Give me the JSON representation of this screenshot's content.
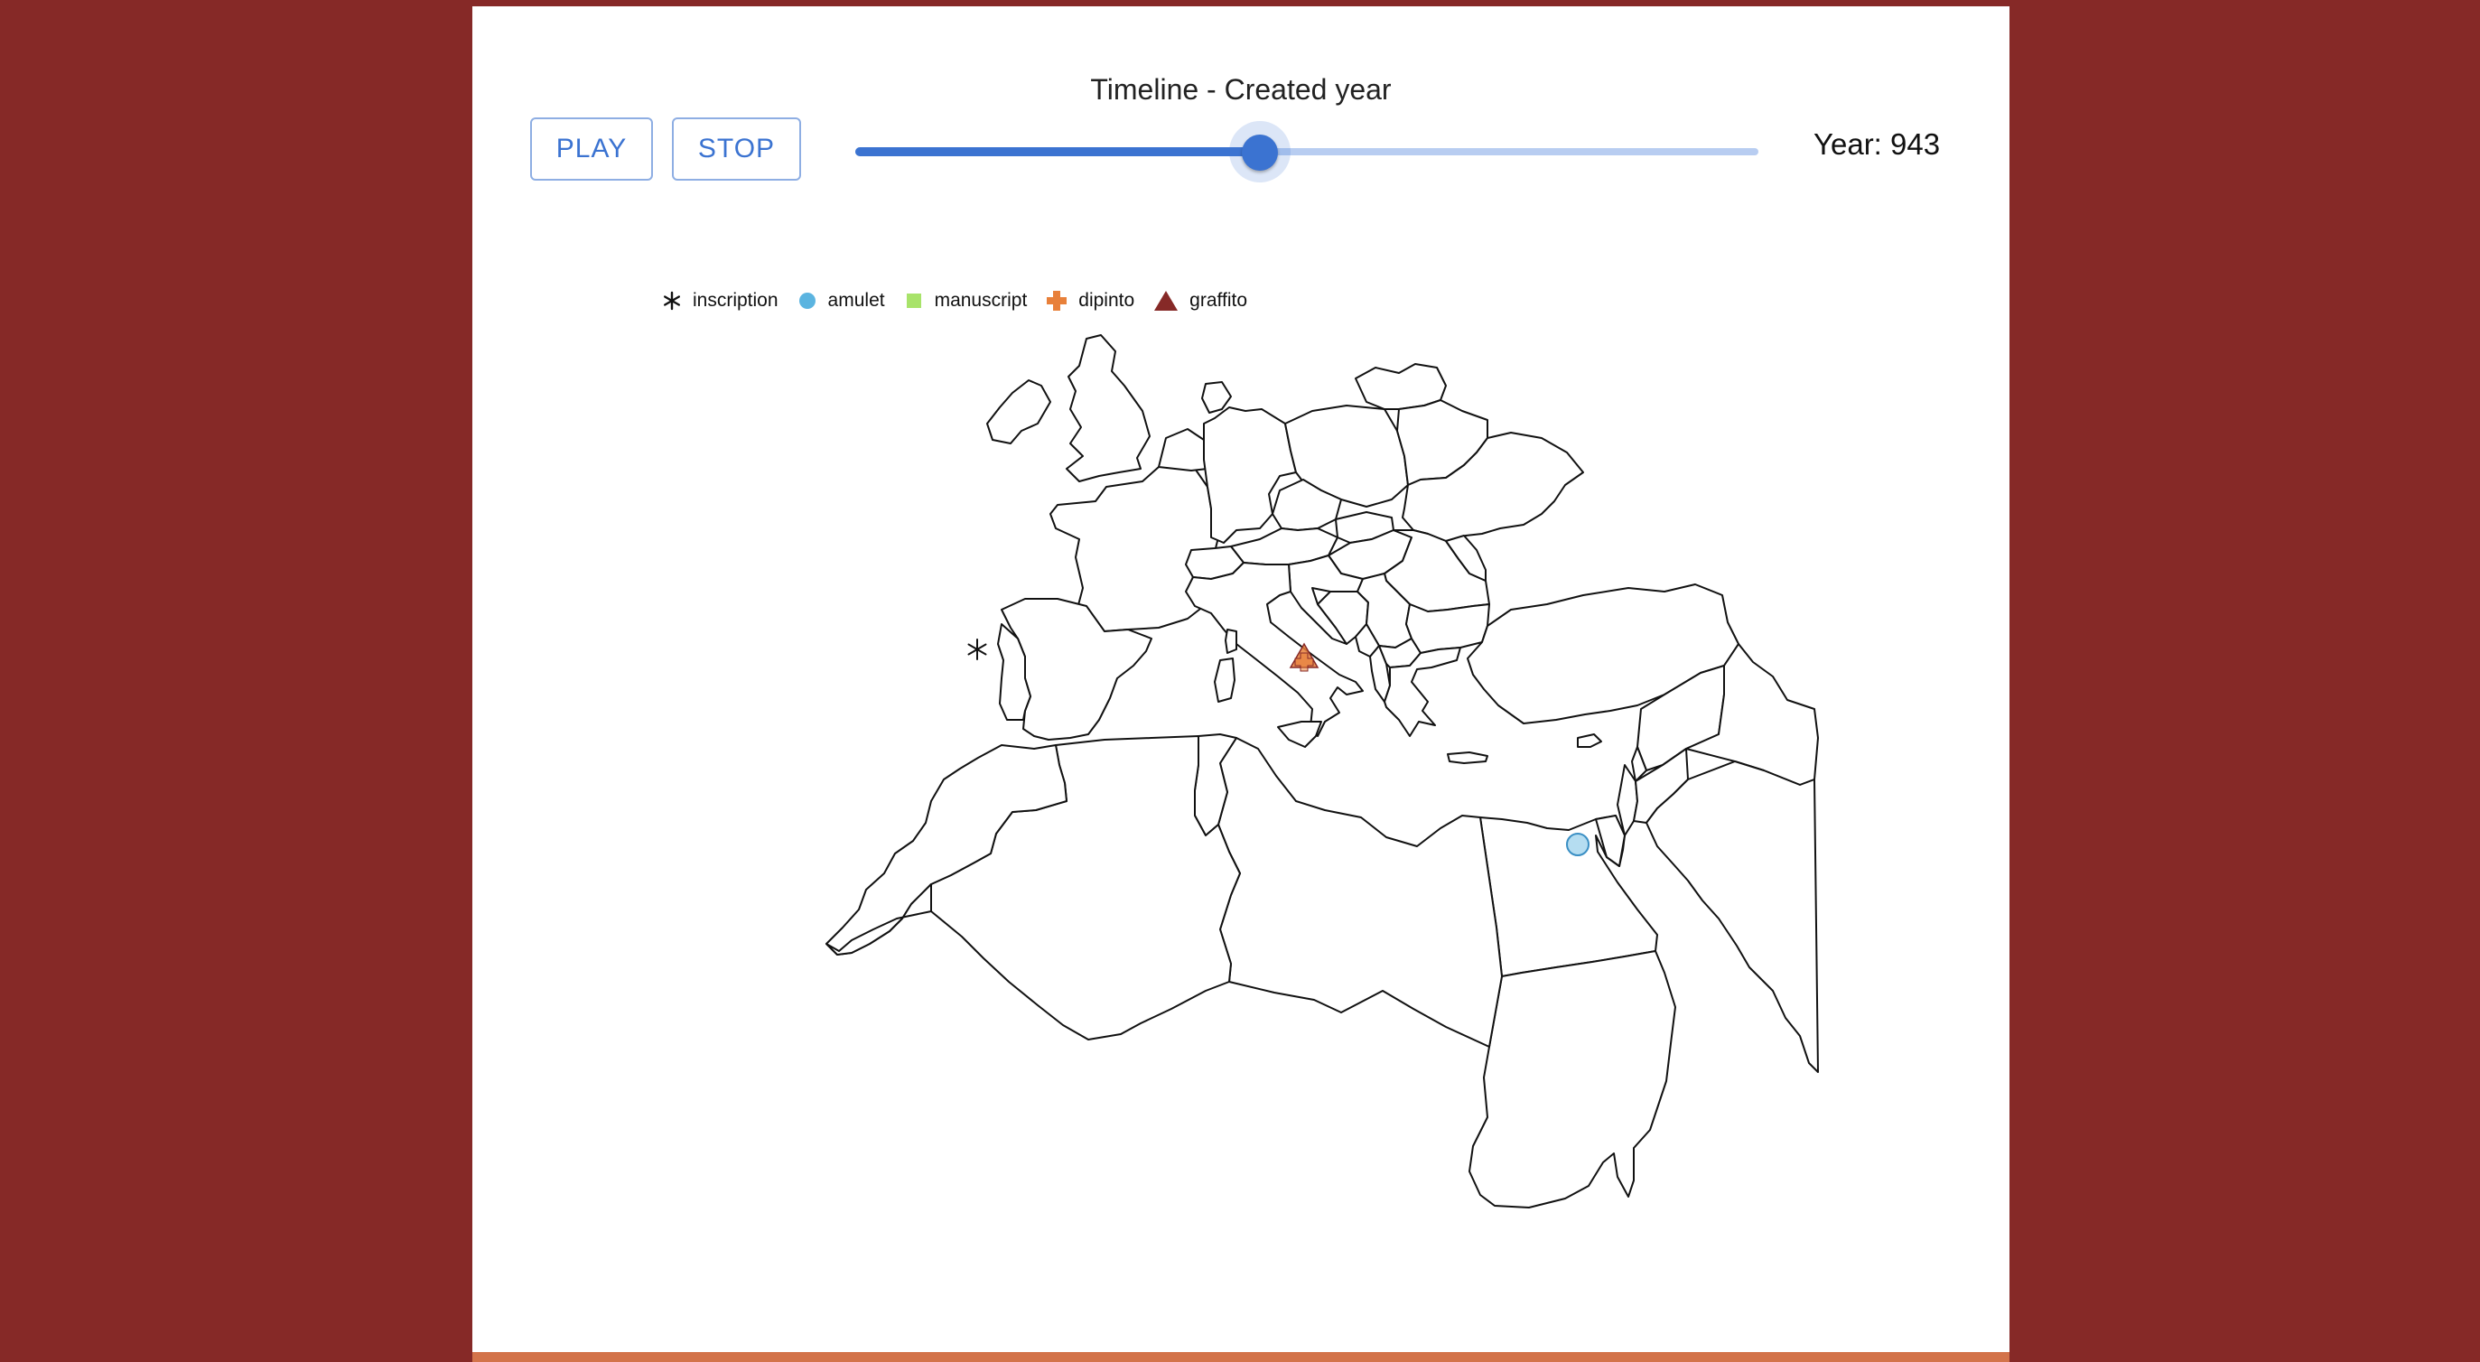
{
  "timeline": {
    "title": "Timeline - Created year",
    "play_label": "PLAY",
    "stop_label": "STOP",
    "slider_value_fraction": 0.448,
    "year_label": "Year: 943"
  },
  "legend": {
    "items": [
      {
        "label": "inscription",
        "icon": "asterisk-icon",
        "color": "#111111"
      },
      {
        "label": "amulet",
        "icon": "circle-icon",
        "color": "#5bb4e0"
      },
      {
        "label": "manuscript",
        "icon": "square-icon",
        "color": "#a8e36a"
      },
      {
        "label": "dipinto",
        "icon": "cross-icon",
        "color": "#e8803a"
      },
      {
        "label": "graffito",
        "icon": "triangle-icon",
        "color": "#862927"
      }
    ]
  },
  "colors": {
    "background": "#862927",
    "accent": "#3b73d1",
    "bottom_bar": "#d3734a"
  },
  "map": {
    "region": "Europe, Mediterranean and North Africa",
    "markers": [
      {
        "type": "inscription",
        "location": "Portugal"
      },
      {
        "type": "graffito",
        "location": "Rome, Italy"
      },
      {
        "type": "dipinto",
        "location": "Rome, Italy"
      },
      {
        "type": "amulet",
        "location": "Egypt, Nile Delta"
      }
    ]
  }
}
